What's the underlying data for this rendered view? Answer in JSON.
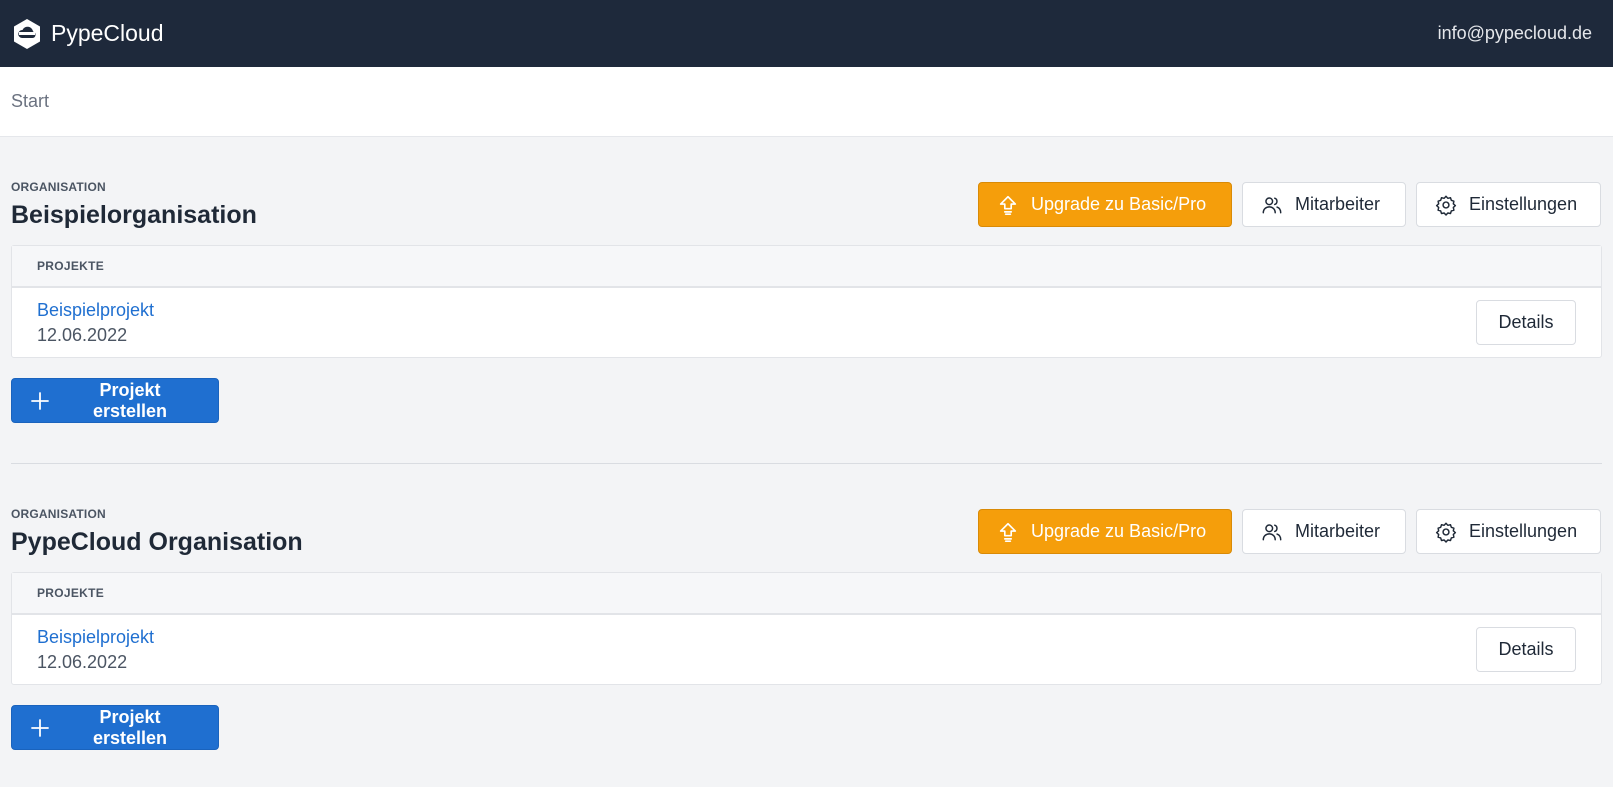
{
  "navbar": {
    "brand": "PypeCloud",
    "email": "info@pypecloud.de"
  },
  "breadcrumb": {
    "items": [
      "Start"
    ]
  },
  "organizations": [
    {
      "kicker": "ORGANISATION",
      "name": "Beispielorganisation",
      "actions": {
        "upgrade": "Upgrade zu Basic/Pro",
        "staff": "Mitarbeiter",
        "settings": "Einstellungen"
      },
      "projects_header": "PROJEKTE",
      "projects": [
        {
          "name": "Beispielprojekt",
          "date": "12.06.2022",
          "details": "Details"
        }
      ],
      "create_label": "Projekt erstellen"
    },
    {
      "kicker": "ORGANISATION",
      "name": "PypeCloud Organisation",
      "actions": {
        "upgrade": "Upgrade zu Basic/Pro",
        "staff": "Mitarbeiter",
        "settings": "Einstellungen"
      },
      "projects_header": "PROJEKTE",
      "projects": [
        {
          "name": "Beispielprojekt",
          "date": "12.06.2022",
          "details": "Details"
        }
      ],
      "create_label": "Projekt erstellen"
    }
  ],
  "icons": {
    "brand": "pypecloud-logo-icon",
    "upgrade": "upload-arrow-icon",
    "staff": "users-icon",
    "settings": "gear-icon",
    "create": "plus-icon"
  },
  "colors": {
    "navbar_bg": "#1e293b",
    "upgrade": "#f59e0b",
    "primary": "#1f6fd0",
    "page_bg": "#f3f4f6"
  }
}
